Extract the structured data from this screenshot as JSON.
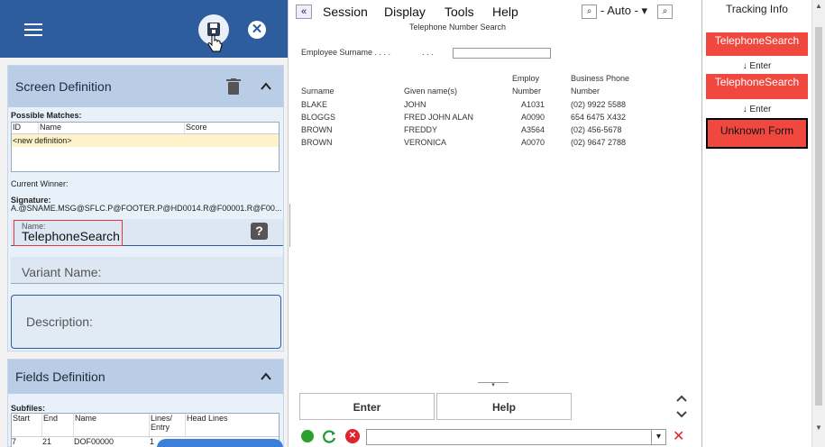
{
  "left": {
    "screen_definition": {
      "title": "Screen Definition",
      "possible_matches_label": "Possible Matches:",
      "columns": [
        "ID",
        "Name",
        "Score"
      ],
      "new_definition": "<new definition>",
      "current_winner_label": "Current Winner:",
      "signature_label": "Signature:",
      "signature_value": "A.@SNAME.MSG@SFLC.P@FOOTER.P@HD0014.R@F00001.R@F00...",
      "name_label": "Name:",
      "name_value": "TelephoneSearch",
      "variant_name_label": "Variant Name:",
      "description_label": "Description:"
    },
    "fields_definition": {
      "title": "Fields Definition",
      "subfiles_label": "Subfiles:",
      "columns": [
        "Start",
        "End",
        "Name",
        "Lines/ Entry",
        "Head Lines"
      ],
      "row": [
        "7",
        "21",
        "DOF00000",
        "1",
        ""
      ]
    }
  },
  "mid": {
    "menu": [
      "Session",
      "Display",
      "Tools",
      "Help"
    ],
    "mode": "- Auto -",
    "screen_title": "Telephone Number Search",
    "surname_prompt": "Employee Surname . . . .",
    "dots": ". . .",
    "headers": {
      "employ": "Employ",
      "business_phone": "Business Phone",
      "surname": "Surname",
      "given": "Given name(s)",
      "number": "Number",
      "number2": "Number"
    },
    "rows": [
      {
        "surname": "BLAKE",
        "given": "JOHN",
        "num": "A1031",
        "phone": "(02) 9922 5588"
      },
      {
        "surname": "BLOGGS",
        "given": "FRED JOHN ALAN",
        "num": "A0090",
        "phone": "654 6475 X432"
      },
      {
        "surname": "BROWN",
        "given": "FREDDY",
        "num": "A3564",
        "phone": "(02) 456-5678"
      },
      {
        "surname": "BROWN",
        "given": "VERONICA",
        "num": "A0070",
        "phone": "(02) 9647 2788"
      }
    ],
    "enter_label": "Enter",
    "help_label": "Help"
  },
  "right": {
    "title": "Tracking Info",
    "items": [
      "TelephoneSearch",
      "↓ Enter",
      "TelephoneSearch",
      "↓ Enter",
      "Unknown Form"
    ]
  },
  "colors": {
    "header_blue": "#2e5d9e",
    "track_red": "#f0473e"
  }
}
